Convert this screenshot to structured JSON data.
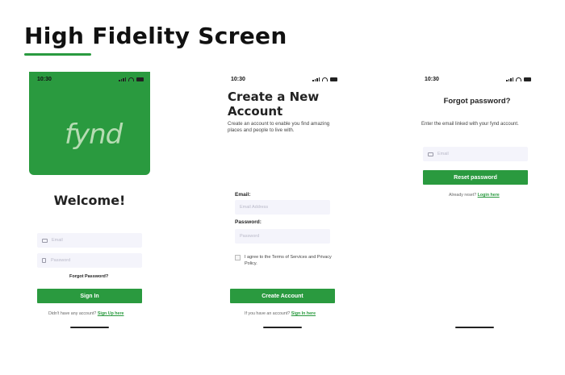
{
  "page": {
    "title": "High Fidelity Screen",
    "accent": "#2a9a3f"
  },
  "status": {
    "time": "10:30"
  },
  "screen1": {
    "logo": "fynd",
    "heading": "Welcome!",
    "email_placeholder": "Email",
    "password_placeholder": "Password",
    "forgot_link": "Forgot Password?",
    "sign_in_button": "Sign In",
    "footer_text": "Didn't have any account?",
    "footer_link": "Sign Up here"
  },
  "screen2": {
    "heading_line1": "Create a New",
    "heading_line2": "Account",
    "description": "Create an account to enable you find amazing places and people to live with.",
    "email_label": "Email:",
    "email_placeholder": "Email Address",
    "password_label": "Password:",
    "password_placeholder": "Password",
    "agree_text": "I agree to the Terms of Services and Privacy Policy.",
    "create_button": "Create Account",
    "footer_text": "If you have an account?",
    "footer_link": "Sign In here"
  },
  "screen3": {
    "heading": "Forgot password?",
    "description": "Enter the email linked with your fynd account.",
    "email_placeholder": "Email",
    "reset_button": "Reset password",
    "footer_text": "Already reset?",
    "footer_link": "Login here"
  }
}
